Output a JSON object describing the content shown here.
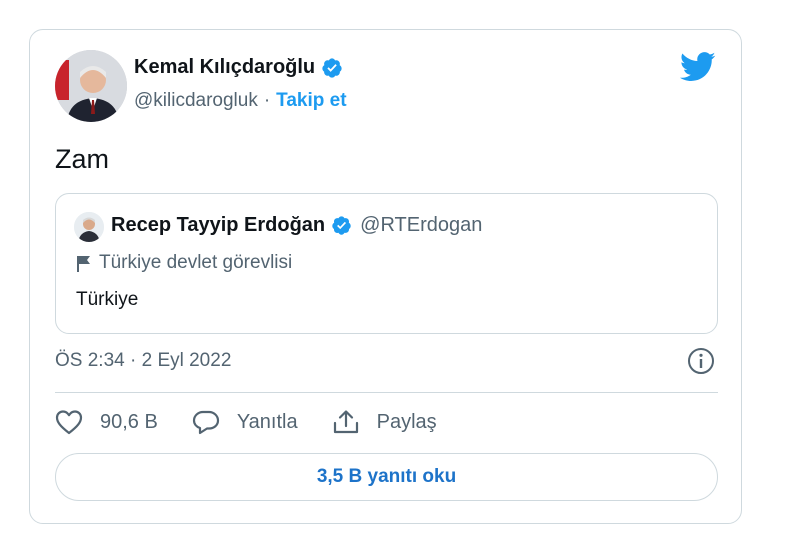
{
  "author": {
    "name": "Kemal Kılıçdaroğlu",
    "handle": "@kilicdarogluk",
    "separator": "·",
    "follow_label": "Takip et"
  },
  "tweet": {
    "text": "Zam",
    "timestamp": "ÖS 2:34 · 2 Eyl 2022"
  },
  "quoted": {
    "name": "Recep Tayyip Erdoğan",
    "handle": "@RTErdogan",
    "label": "Türkiye devlet görevlisi",
    "text": "Türkiye"
  },
  "actions": {
    "likes": "90,6 B",
    "reply_label": "Yanıtla",
    "share_label": "Paylaş"
  },
  "read_replies_label": "3,5 B yanıtı oku",
  "colors": {
    "accent": "#1d9bf0",
    "text": "#0f1419",
    "muted": "#536471",
    "border": "#cfd9de"
  },
  "icons": [
    "verified-badge-icon",
    "twitter-bird-icon",
    "government-flag-icon",
    "info-icon",
    "heart-icon",
    "reply-bubble-icon",
    "share-icon"
  ]
}
